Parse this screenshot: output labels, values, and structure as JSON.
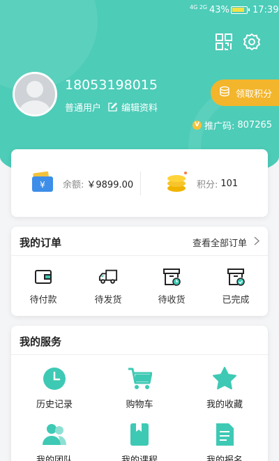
{
  "status_bar": {
    "signal": "4G 2G",
    "battery_percent": "43%",
    "time": "17:39"
  },
  "profile": {
    "phone": "18053198015",
    "user_type": "普通用户",
    "edit_label": "编辑资料",
    "points_button": "领取积分",
    "promo_label": "推广码:",
    "promo_code": "807265"
  },
  "balance": {
    "balance_label": "余额:",
    "balance_value": "￥9899.00",
    "points_label": "积分:",
    "points_value": "101"
  },
  "orders": {
    "title": "我的订单",
    "view_all": "查看全部订单",
    "items": [
      {
        "label": "待付款",
        "icon": "wallet-icon"
      },
      {
        "label": "待发货",
        "icon": "truck-icon"
      },
      {
        "label": "待收货",
        "icon": "box-clock-icon"
      },
      {
        "label": "已完成",
        "icon": "box-check-icon"
      }
    ]
  },
  "services": {
    "title": "我的服务",
    "items": [
      {
        "label": "历史记录",
        "icon": "clock-icon"
      },
      {
        "label": "购物车",
        "icon": "cart-icon"
      },
      {
        "label": "我的收藏",
        "icon": "star-icon"
      },
      {
        "label": "我的团队",
        "icon": "team-icon"
      },
      {
        "label": "我的课程",
        "icon": "book-icon"
      },
      {
        "label": "我的报名",
        "icon": "form-icon"
      }
    ]
  },
  "colors": {
    "primary": "#4dccb8",
    "accent": "#f3b52b",
    "icon_teal": "#3ec9b4"
  }
}
